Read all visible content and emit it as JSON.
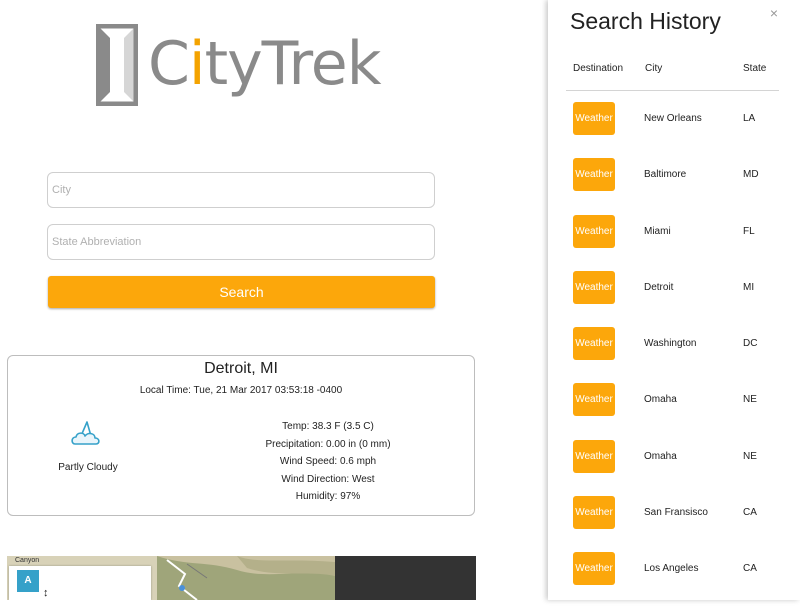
{
  "logo": {
    "text_prefix": "C",
    "text_accent": "i",
    "text_suffix": "tyTrek"
  },
  "colors": {
    "accent": "#fca70b",
    "logo_gray": "#8a8a8a",
    "map_marker": "#35a1c9"
  },
  "search_form": {
    "city_placeholder": "City",
    "state_placeholder": "State Abbreviation",
    "search_label": "Search"
  },
  "weather": {
    "city": "Detroit, MI",
    "local_time": "Local Time: Tue, 21 Mar 2017 03:53:18 -0400",
    "condition": "Partly Cloudy",
    "icon": "partly-cloudy-icon",
    "temp": "Temp: 38.3 F (3.5 C)",
    "precipitation": "Precipitation: 0.00 in (0 mm)",
    "wind_speed": "Wind Speed: 0.6 mph",
    "wind_direction": "Wind Direction: West",
    "humidity": "Humidity: 97%"
  },
  "map": {
    "label": "Canyon",
    "marker_label": "A",
    "arrow": "↕"
  },
  "history": {
    "title": "Search History",
    "close_label": "×",
    "columns": {
      "destination": "Destination",
      "city": "City",
      "state": "State"
    },
    "rows": [
      {
        "button": "Weather",
        "city": "New Orleans",
        "state": "LA"
      },
      {
        "button": "Weather",
        "city": "Baltimore",
        "state": "MD"
      },
      {
        "button": "Weather",
        "city": "Miami",
        "state": "FL"
      },
      {
        "button": "Weather",
        "city": "Detroit",
        "state": "MI"
      },
      {
        "button": "Weather",
        "city": "Washington",
        "state": "DC"
      },
      {
        "button": "Weather",
        "city": "Omaha",
        "state": "NE"
      },
      {
        "button": "Weather",
        "city": "Omaha",
        "state": "NE"
      },
      {
        "button": "Weather",
        "city": "San Fransisco",
        "state": "CA"
      },
      {
        "button": "Weather",
        "city": "Los Angeles",
        "state": "CA"
      }
    ]
  }
}
